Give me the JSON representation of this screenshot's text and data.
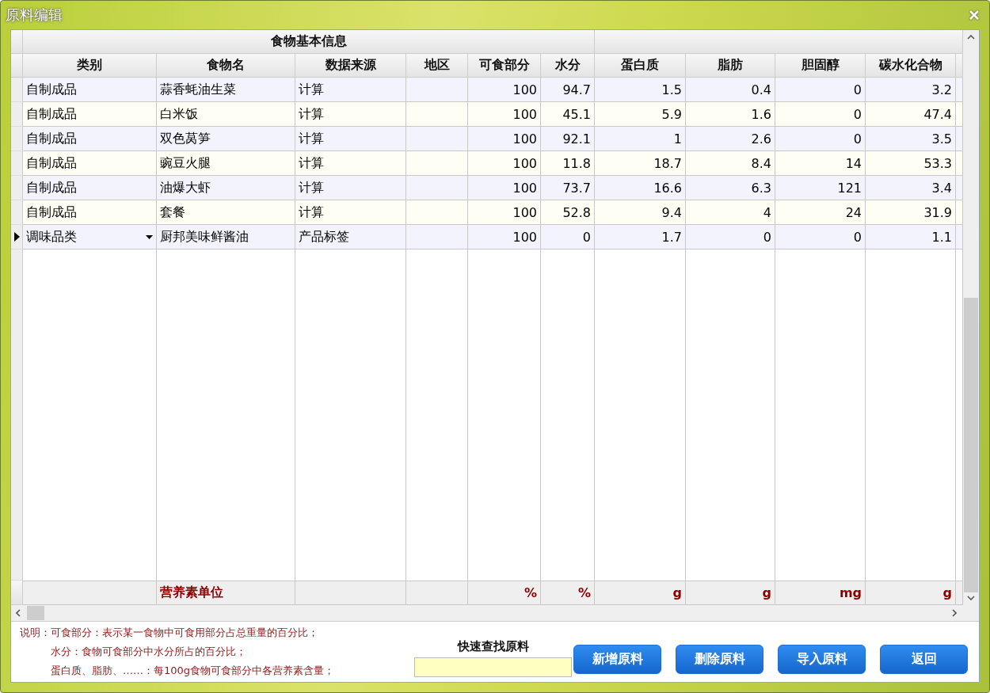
{
  "window": {
    "title": "原料编辑"
  },
  "table": {
    "column_groups": [
      {
        "label": "食物基本信息",
        "columns": [
          {
            "label": "类别",
            "kind": "text"
          },
          {
            "label": "食物名",
            "kind": "text"
          },
          {
            "label": "数据来源",
            "kind": "text"
          },
          {
            "label": "地区",
            "kind": "text"
          },
          {
            "label": "可食部分",
            "kind": "number",
            "unit": "%"
          },
          {
            "label": "水分",
            "kind": "number",
            "unit": "%"
          }
        ]
      },
      {
        "columns": [
          {
            "label": "蛋白质",
            "kind": "number",
            "unit": "g"
          },
          {
            "label": "脂肪",
            "kind": "number",
            "unit": "g"
          },
          {
            "label": "胆固醇",
            "kind": "number",
            "unit": "mg"
          },
          {
            "label": "碳水化合物",
            "kind": "number",
            "unit": "g"
          }
        ]
      }
    ],
    "rows": [
      {
        "current": false,
        "cells": [
          "自制成品",
          "蒜香蚝油生菜",
          "计算",
          null,
          "100",
          "94.7",
          "1.5",
          "0.4",
          "0",
          "3.2"
        ]
      },
      {
        "current": false,
        "cells": [
          "自制成品",
          "白米饭",
          "计算",
          null,
          "100",
          "45.1",
          "5.9",
          "1.6",
          "0",
          "47.4"
        ]
      },
      {
        "current": false,
        "cells": [
          "自制成品",
          "双色莴笋",
          "计算",
          null,
          "100",
          "92.1",
          "1",
          "2.6",
          "0",
          "3.5"
        ]
      },
      {
        "current": false,
        "cells": [
          "自制成品",
          "豌豆火腿",
          "计算",
          null,
          "100",
          "11.8",
          "18.7",
          "8.4",
          "14",
          "53.3"
        ]
      },
      {
        "current": false,
        "cells": [
          "自制成品",
          "油爆大虾",
          "计算",
          null,
          "100",
          "73.7",
          "16.6",
          "6.3",
          "121",
          "3.4"
        ]
      },
      {
        "current": false,
        "cells": [
          "自制成品",
          "套餐",
          "计算",
          null,
          "100",
          "52.8",
          "9.4",
          "4",
          "24",
          "31.9"
        ]
      },
      {
        "current": true,
        "cells": [
          "调味品类",
          "厨邦美味鲜酱油",
          "产品标签",
          null,
          "100",
          "0",
          "1.7",
          "0",
          "0",
          "1.1"
        ]
      }
    ],
    "units_label": "营养素单位"
  },
  "notes": {
    "label": "说明：",
    "lines": [
      "可食部分：表示某一食物中可食用部分占总重量的百分比；",
      "水分：食物可食部分中水分所占的百分比；",
      "蛋白质、脂肪、……：每100g食物可食部分中各营养素含量；"
    ]
  },
  "search": {
    "label": "快速查找原料"
  },
  "buttons": [
    "新增原料",
    "删除原料",
    "导入原料",
    "返回"
  ]
}
